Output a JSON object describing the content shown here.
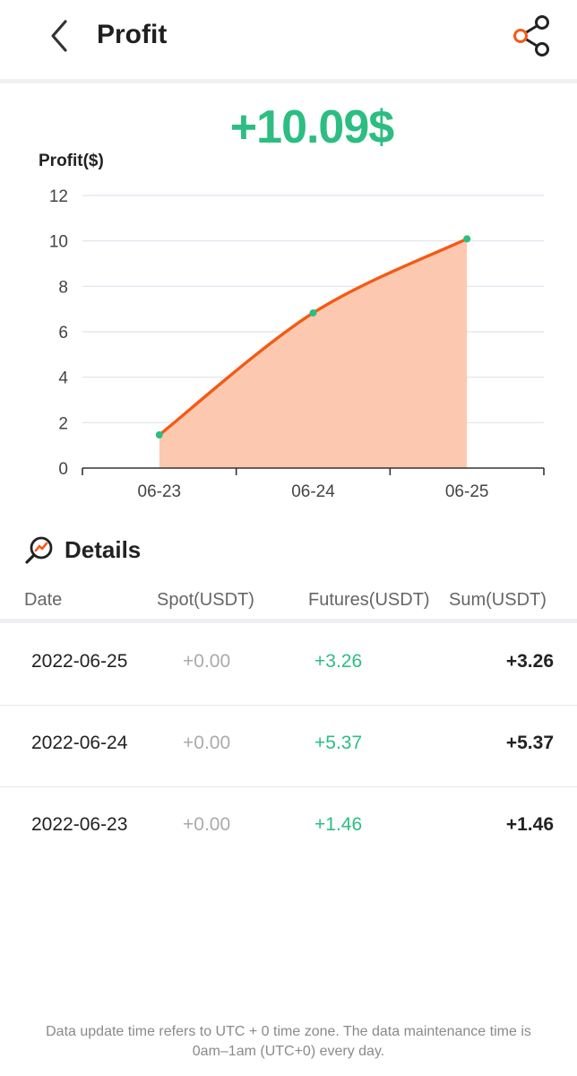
{
  "header": {
    "title": "Profit",
    "back_icon": "chevron-left-icon",
    "share_icon": "share-icon"
  },
  "summary": {
    "total_profit": "+10.09$"
  },
  "colors": {
    "accent_green": "#2dbd82",
    "line_orange": "#f45a14",
    "area_fill": "#fcc9b0",
    "grid": "#dfe2ee"
  },
  "chart_data": {
    "type": "area",
    "ylabel": "Profit($)",
    "categories": [
      "06-23",
      "06-24",
      "06-25"
    ],
    "values": [
      1.46,
      6.83,
      10.09
    ],
    "ylim": [
      0,
      12
    ],
    "yticks": [
      0,
      2,
      4,
      6,
      8,
      10,
      12
    ],
    "grid": true
  },
  "details": {
    "title": "Details",
    "icon": "trend-chart-icon",
    "columns": [
      "Date",
      "Spot(USDT)",
      "Futures(USDT)",
      "Sum(USDT)"
    ],
    "rows": [
      {
        "date": "2022-06-25",
        "spot": "+0.00",
        "futures": "+3.26",
        "sum": "+3.26"
      },
      {
        "date": "2022-06-24",
        "spot": "+0.00",
        "futures": "+5.37",
        "sum": "+5.37"
      },
      {
        "date": "2022-06-23",
        "spot": "+0.00",
        "futures": "+1.46",
        "sum": "+1.46"
      }
    ]
  },
  "footer": {
    "line1": "Data update time refers to UTC + 0 time zone. The data maintenance time is",
    "line2": "0am–1am (UTC+0) every day."
  }
}
